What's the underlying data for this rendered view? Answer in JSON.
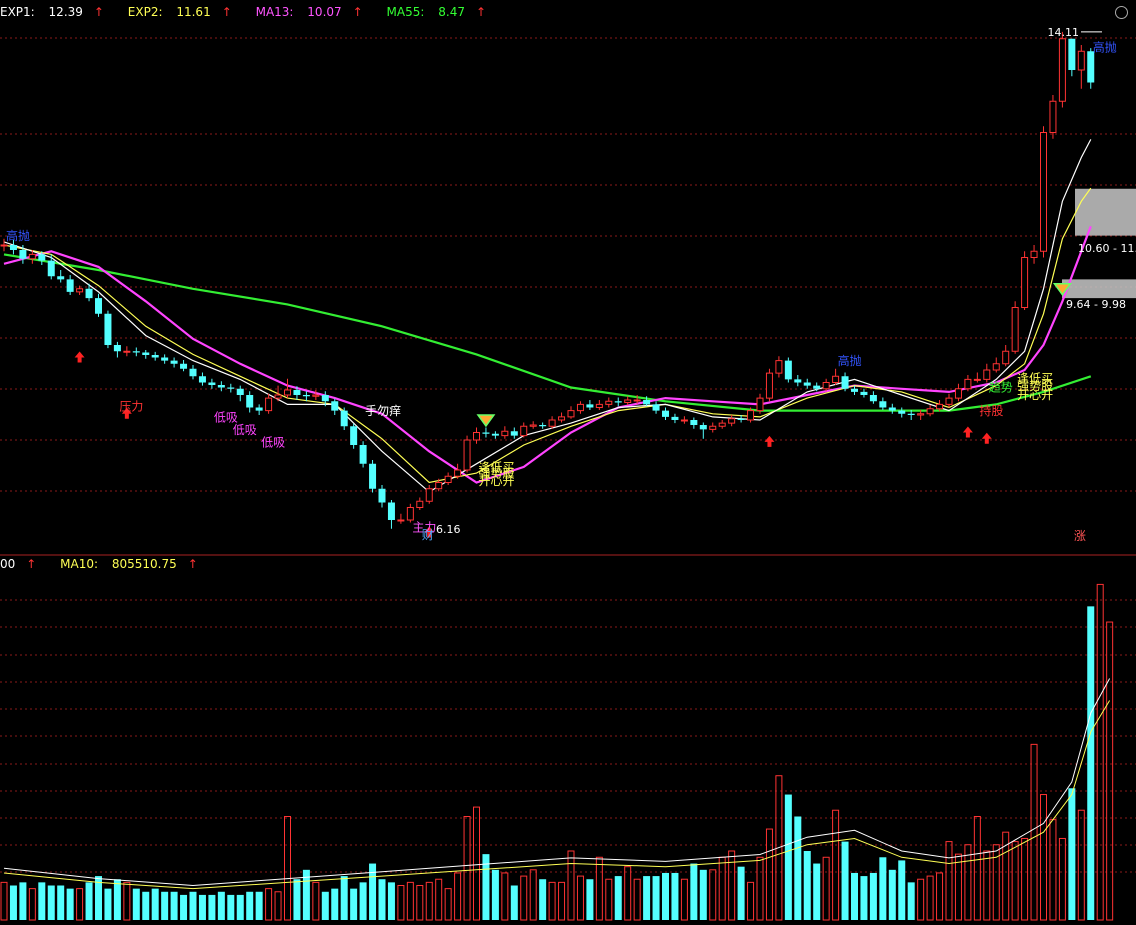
{
  "legend_top": [
    {
      "label": "EXP1:",
      "value": "12.39",
      "arrow": "↑",
      "color": "#ffffff"
    },
    {
      "label": "EXP2:",
      "value": "11.61",
      "arrow": "↑",
      "color": "#ffff55"
    },
    {
      "label": "MA13:",
      "value": "10.07",
      "arrow": "↑",
      "color": "#ff55ff"
    },
    {
      "label": "MA55:",
      "value": "8.47",
      "arrow": "↑",
      "color": "#33ff33"
    }
  ],
  "legend_bottom": [
    {
      "label": "",
      "value": "00",
      "arrow": "↑",
      "color": "#ffffff"
    },
    {
      "label": "MA10:",
      "value": "805510.75",
      "arrow": "↑",
      "color": "#ffff55"
    }
  ],
  "colors": {
    "background": "#000000",
    "up": "#ff3333",
    "down": "#54ffff",
    "exp1": "#ffffff",
    "exp2": "#ffff55",
    "ma13": "#ff44ff",
    "ma55": "#33ee33",
    "grid": "#8a1a1a",
    "zone": "#c8c8c8"
  },
  "price_labels": {
    "high": "14.11",
    "low": "6.16",
    "zone_upper": "10.60 - 11.",
    "zone_lower": "9.64 - 9.98"
  },
  "signals": [
    {
      "text": "高抛",
      "color": "#3355ff",
      "i": 0,
      "y": 10.78
    },
    {
      "text": "压力",
      "color": "#ff3333",
      "i": 12,
      "y": 8.05
    },
    {
      "text": "低吸",
      "color": "#ff44ff",
      "i": 22,
      "y": 7.88
    },
    {
      "text": "低吸",
      "color": "#ff44ff",
      "i": 24,
      "y": 7.68
    },
    {
      "text": "低吸",
      "color": "#ff44ff",
      "i": 27,
      "y": 7.48
    },
    {
      "text": "手勿痒",
      "color": "#ffffff",
      "i": 38,
      "y": 7.98
    },
    {
      "text": "逢低买",
      "color": "#ffff55",
      "i": 50,
      "y": 7.08
    },
    {
      "text": "强势股",
      "color": "#ffff55",
      "i": 50,
      "y": 6.98
    },
    {
      "text": "开心开",
      "color": "#ffff55",
      "i": 50,
      "y": 6.86
    },
    {
      "text": "主力",
      "color": "#ff55ff",
      "i": 43,
      "y": 6.12
    },
    {
      "text": "财",
      "color": "#55aaff",
      "i": 44,
      "y": 6.0
    },
    {
      "text": "高抛",
      "color": "#3355ff",
      "i": 88,
      "y": 8.78
    },
    {
      "text": "逢低买",
      "color": "#ffff55",
      "i": 107,
      "y": 8.5
    },
    {
      "text": "强势股",
      "color": "#ffff55",
      "i": 107,
      "y": 8.38
    },
    {
      "text": "开心开",
      "color": "#ffff55",
      "i": 107,
      "y": 8.24
    },
    {
      "text": "趋势",
      "color": "#33ee33",
      "i": 104,
      "y": 8.36
    },
    {
      "text": "持股",
      "color": "#ff3333",
      "i": 103,
      "y": 7.98
    },
    {
      "text": "高抛",
      "color": "#3355ff",
      "i": 115,
      "y": 13.8
    },
    {
      "text": "涨",
      "color": "#ff5555",
      "i": 113,
      "y": 5.98
    }
  ],
  "chart_data": [
    {
      "type": "candlestick",
      "name": "price",
      "x": [
        0,
        1,
        2,
        3,
        4,
        5,
        6,
        7,
        8,
        9,
        10,
        11,
        12,
        13,
        14,
        15,
        16,
        17,
        18,
        19,
        20,
        21,
        22,
        23,
        24,
        25,
        26,
        27,
        28,
        29,
        30,
        31,
        32,
        33,
        34,
        35,
        36,
        37,
        38,
        39,
        40,
        41,
        42,
        43,
        44,
        45,
        46,
        47,
        48,
        49,
        50,
        51,
        52,
        53,
        54,
        55,
        56,
        57,
        58,
        59,
        60,
        61,
        62,
        63,
        64,
        65,
        66,
        67,
        68,
        69,
        70,
        71,
        72,
        73,
        74,
        75,
        76,
        77,
        78,
        79,
        80,
        81,
        82,
        83,
        84,
        85,
        86,
        87,
        88,
        89,
        90,
        91,
        92,
        93,
        94,
        95,
        96,
        97,
        98,
        99,
        100,
        101,
        102,
        103,
        104,
        105,
        106,
        107,
        108,
        109,
        110,
        111,
        112,
        113,
        114,
        115
      ],
      "open": [
        10.7,
        10.7,
        10.62,
        10.48,
        10.55,
        10.45,
        10.2,
        10.15,
        9.95,
        10.0,
        9.85,
        9.6,
        9.1,
        9.0,
        9.0,
        8.98,
        8.94,
        8.9,
        8.85,
        8.8,
        8.72,
        8.6,
        8.5,
        8.46,
        8.42,
        8.4,
        8.3,
        8.1,
        8.05,
        8.25,
        8.3,
        8.38,
        8.3,
        8.28,
        8.3,
        8.2,
        8.05,
        7.8,
        7.5,
        7.2,
        6.8,
        6.58,
        6.3,
        6.3,
        6.5,
        6.6,
        6.8,
        6.9,
        7.0,
        7.1,
        7.58,
        7.7,
        7.68,
        7.65,
        7.72,
        7.65,
        7.8,
        7.82,
        7.8,
        7.9,
        7.95,
        8.05,
        8.15,
        8.1,
        8.15,
        8.2,
        8.18,
        8.22,
        8.22,
        8.15,
        8.05,
        7.95,
        7.9,
        7.9,
        7.82,
        7.75,
        7.8,
        7.85,
        7.92,
        7.9,
        8.05,
        8.25,
        8.65,
        8.85,
        8.55,
        8.5,
        8.45,
        8.4,
        8.5,
        8.6,
        8.4,
        8.35,
        8.3,
        8.2,
        8.1,
        8.05,
        8.0,
        7.98,
        8.0,
        8.08,
        8.15,
        8.25,
        8.4,
        8.55,
        8.55,
        8.7,
        8.8,
        9.0,
        9.7,
        10.5,
        10.6,
        12.5,
        13.0,
        14.0,
        13.5,
        13.8
      ],
      "close": [
        10.7,
        10.62,
        10.48,
        10.55,
        10.45,
        10.2,
        10.15,
        9.95,
        10.0,
        9.85,
        9.6,
        9.1,
        9.0,
        9.0,
        8.98,
        8.94,
        8.9,
        8.85,
        8.8,
        8.72,
        8.6,
        8.5,
        8.46,
        8.42,
        8.4,
        8.3,
        8.1,
        8.05,
        8.25,
        8.3,
        8.38,
        8.3,
        8.28,
        8.3,
        8.2,
        8.05,
        7.8,
        7.5,
        7.2,
        6.8,
        6.58,
        6.3,
        6.3,
        6.5,
        6.6,
        6.8,
        6.9,
        7.0,
        7.1,
        7.58,
        7.7,
        7.68,
        7.65,
        7.72,
        7.65,
        7.8,
        7.82,
        7.8,
        7.9,
        7.95,
        8.05,
        8.15,
        8.1,
        8.15,
        8.2,
        8.18,
        8.22,
        8.22,
        8.15,
        8.05,
        7.95,
        7.9,
        7.9,
        7.82,
        7.75,
        7.8,
        7.85,
        7.92,
        7.9,
        8.05,
        8.25,
        8.65,
        8.85,
        8.55,
        8.5,
        8.45,
        8.4,
        8.5,
        8.6,
        8.4,
        8.35,
        8.3,
        8.2,
        8.1,
        8.05,
        8.0,
        7.98,
        8.0,
        8.08,
        8.15,
        8.25,
        8.4,
        8.55,
        8.55,
        8.7,
        8.8,
        9.0,
        9.7,
        10.5,
        10.6,
        12.5,
        13.0,
        14.0,
        13.5,
        13.8,
        13.3
      ],
      "high": [
        10.8,
        10.78,
        10.7,
        10.62,
        10.6,
        10.55,
        10.3,
        10.22,
        10.05,
        10.08,
        9.92,
        9.65,
        9.15,
        9.08,
        9.06,
        9.02,
        8.99,
        8.95,
        8.9,
        8.86,
        8.78,
        8.66,
        8.56,
        8.52,
        8.48,
        8.45,
        8.36,
        8.15,
        8.32,
        8.45,
        8.56,
        8.44,
        8.36,
        8.38,
        8.36,
        8.24,
        8.1,
        7.84,
        7.56,
        7.26,
        6.86,
        6.62,
        6.4,
        6.56,
        6.66,
        6.86,
        6.96,
        7.06,
        7.2,
        7.65,
        7.78,
        7.78,
        7.72,
        7.8,
        7.78,
        7.86,
        7.88,
        7.86,
        7.96,
        8.02,
        8.12,
        8.2,
        8.22,
        8.22,
        8.26,
        8.26,
        8.28,
        8.3,
        8.28,
        8.2,
        8.1,
        8.0,
        7.96,
        7.94,
        7.86,
        7.86,
        7.9,
        7.98,
        7.98,
        8.1,
        8.32,
        8.72,
        8.92,
        8.9,
        8.62,
        8.56,
        8.5,
        8.56,
        8.72,
        8.66,
        8.45,
        8.4,
        8.36,
        8.26,
        8.16,
        8.1,
        8.06,
        8.06,
        8.14,
        8.22,
        8.32,
        8.48,
        8.62,
        8.66,
        8.8,
        8.9,
        9.1,
        9.8,
        10.6,
        10.7,
        12.6,
        13.1,
        14.11,
        14.0,
        13.9,
        13.85
      ],
      "low": [
        10.6,
        10.55,
        10.4,
        10.4,
        10.38,
        10.15,
        10.1,
        9.9,
        9.9,
        9.8,
        9.55,
        9.05,
        8.9,
        8.92,
        8.92,
        8.88,
        8.85,
        8.8,
        8.74,
        8.68,
        8.55,
        8.45,
        8.4,
        8.36,
        8.34,
        8.2,
        8.02,
        7.98,
        8.0,
        8.2,
        8.25,
        8.22,
        8.2,
        8.22,
        8.12,
        7.98,
        7.74,
        7.44,
        7.14,
        6.74,
        6.5,
        6.16,
        6.24,
        6.26,
        6.46,
        6.56,
        6.76,
        6.86,
        6.96,
        7.06,
        7.52,
        7.62,
        7.6,
        7.6,
        7.6,
        7.62,
        7.76,
        7.76,
        7.76,
        7.86,
        7.92,
        8.0,
        8.06,
        8.06,
        8.1,
        8.12,
        8.14,
        8.16,
        8.12,
        8.0,
        7.9,
        7.85,
        7.84,
        7.76,
        7.6,
        7.7,
        7.76,
        7.8,
        7.86,
        7.86,
        8.0,
        8.2,
        8.58,
        8.5,
        8.44,
        8.4,
        8.36,
        8.36,
        8.46,
        8.36,
        8.3,
        8.26,
        8.16,
        8.06,
        8.0,
        7.94,
        7.9,
        7.9,
        7.96,
        8.04,
        8.1,
        8.2,
        8.36,
        8.5,
        8.5,
        8.66,
        8.76,
        8.96,
        9.66,
        10.4,
        10.5,
        12.4,
        12.9,
        13.4,
        13.2,
        13.2
      ]
    },
    {
      "type": "line",
      "name": "MA55",
      "x": [
        0,
        10,
        20,
        30,
        40,
        50,
        60,
        70,
        80,
        90,
        100,
        105,
        110,
        115
      ],
      "y": [
        10.55,
        10.3,
        10.0,
        9.75,
        9.4,
        8.95,
        8.42,
        8.2,
        8.05,
        8.05,
        8.05,
        8.15,
        8.35,
        8.6
      ]
    },
    {
      "type": "line",
      "name": "MA13",
      "x": [
        0,
        5,
        10,
        15,
        20,
        25,
        30,
        35,
        40,
        45,
        50,
        55,
        60,
        65,
        70,
        75,
        80,
        85,
        90,
        95,
        100,
        105,
        108,
        110,
        112,
        114,
        115
      ],
      "y": [
        10.4,
        10.6,
        10.35,
        9.8,
        9.2,
        8.8,
        8.45,
        8.25,
        8.0,
        7.4,
        6.9,
        7.15,
        7.7,
        8.1,
        8.25,
        8.2,
        8.15,
        8.3,
        8.45,
        8.4,
        8.35,
        8.5,
        8.7,
        9.1,
        9.8,
        10.6,
        11.0
      ]
    },
    {
      "type": "line",
      "name": "EXP2",
      "x": [
        0,
        5,
        10,
        15,
        20,
        25,
        30,
        35,
        40,
        45,
        50,
        55,
        60,
        65,
        70,
        75,
        80,
        85,
        90,
        95,
        100,
        105,
        108,
        110,
        112,
        114,
        115
      ],
      "y": [
        10.7,
        10.55,
        10.05,
        9.4,
        8.95,
        8.6,
        8.25,
        8.15,
        7.6,
        6.9,
        7.05,
        7.5,
        7.8,
        8.05,
        8.15,
        8.0,
        7.95,
        8.25,
        8.45,
        8.35,
        8.1,
        8.45,
        8.8,
        9.6,
        10.8,
        11.4,
        11.61
      ]
    },
    {
      "type": "line",
      "name": "EXP1",
      "x": [
        0,
        5,
        10,
        15,
        20,
        25,
        30,
        35,
        40,
        45,
        50,
        55,
        60,
        65,
        70,
        75,
        80,
        85,
        90,
        95,
        100,
        105,
        108,
        110,
        112,
        114,
        115
      ],
      "y": [
        10.75,
        10.5,
        9.95,
        9.25,
        8.85,
        8.55,
        8.15,
        8.15,
        7.4,
        6.75,
        7.2,
        7.65,
        7.85,
        8.1,
        8.15,
        7.95,
        7.9,
        8.35,
        8.55,
        8.3,
        8.05,
        8.55,
        9.0,
        10.0,
        11.4,
        12.1,
        12.39
      ]
    },
    {
      "type": "bar",
      "name": "volume",
      "values": [
        12,
        11,
        12,
        10,
        12,
        11,
        11,
        10,
        10,
        12,
        14,
        10,
        13,
        12,
        10,
        9,
        10,
        9,
        9,
        8,
        9,
        8,
        8,
        9,
        8,
        8,
        9,
        9,
        10,
        9,
        33,
        13,
        16,
        12,
        9,
        10,
        14,
        10,
        12,
        18,
        13,
        12,
        11,
        12,
        11,
        12,
        13,
        10,
        15,
        33,
        36,
        21,
        16,
        15,
        11,
        14,
        16,
        13,
        12,
        12,
        22,
        14,
        13,
        20,
        13,
        14,
        17,
        13,
        14,
        14,
        15,
        15,
        13,
        18,
        16,
        16,
        20,
        22,
        17,
        12,
        20,
        29,
        46,
        40,
        33,
        22,
        18,
        20,
        35,
        25,
        15,
        14,
        15,
        20,
        16,
        19,
        12,
        13,
        14,
        15,
        25,
        21,
        24,
        33,
        22,
        24,
        28,
        25,
        26,
        56,
        40,
        32,
        26,
        42,
        35,
        100,
        107,
        95
      ]
    },
    {
      "type": "line",
      "name": "MA10 (volume)",
      "x": [
        0,
        10,
        20,
        30,
        40,
        50,
        60,
        70,
        80,
        85,
        90,
        95,
        100,
        105,
        110,
        113,
        115,
        117
      ],
      "y": [
        15,
        12,
        10,
        12,
        14,
        16,
        18,
        17,
        19,
        24,
        26,
        20,
        18,
        20,
        28,
        40,
        60,
        70
      ]
    }
  ]
}
